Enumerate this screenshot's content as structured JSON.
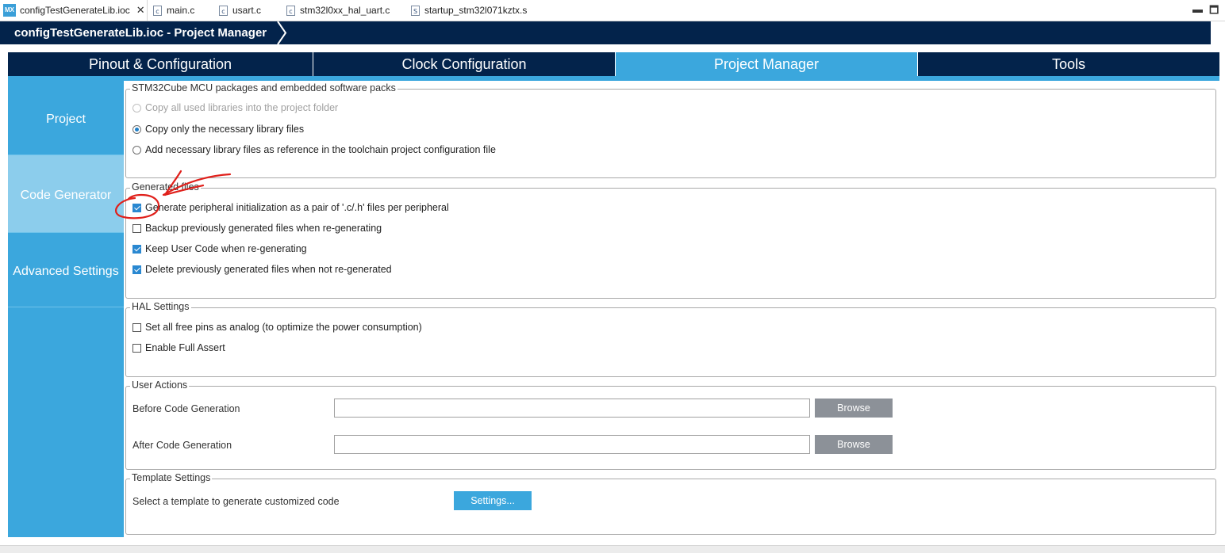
{
  "editor_tabs": [
    {
      "label": "configTestGenerateLib.ioc",
      "icon": "mx-icon"
    },
    {
      "label": "main.c",
      "icon": "c-file-icon"
    },
    {
      "label": "usart.c",
      "icon": "c-file-icon"
    },
    {
      "label": "stm32l0xx_hal_uart.c",
      "icon": "c-file-icon"
    },
    {
      "label": "startup_stm32l071kztx.s",
      "icon": "s-file-icon"
    }
  ],
  "mx_icon_text": "MX",
  "breadcrumb": "configTestGenerateLib.ioc - Project Manager",
  "main_tabs": [
    "Pinout & Configuration",
    "Clock Configuration",
    "Project Manager",
    "Tools"
  ],
  "active_main_tab": "Project Manager",
  "side_nav": [
    "Project",
    "Code Generator",
    "Advanced Settings"
  ],
  "active_side_nav": "Code Generator",
  "packages": {
    "legend": "STM32Cube MCU packages and embedded software packs",
    "options": [
      {
        "label": "Copy all used libraries into the project folder",
        "selected": false,
        "disabled": true
      },
      {
        "label": "Copy only the necessary library files",
        "selected": true,
        "disabled": false
      },
      {
        "label": "Add necessary library files as reference in the toolchain project configuration file",
        "selected": false,
        "disabled": false
      }
    ]
  },
  "generated_files": {
    "legend": "Generated files",
    "options": [
      {
        "label": "Generate peripheral initialization as a pair of '.c/.h' files per peripheral",
        "checked": true
      },
      {
        "label": "Backup previously generated files when re-generating",
        "checked": false
      },
      {
        "label": "Keep User Code when re-generating",
        "checked": true
      },
      {
        "label": "Delete previously generated files when not re-generated",
        "checked": true
      }
    ]
  },
  "hal_settings": {
    "legend": "HAL Settings",
    "options": [
      {
        "label": "Set all free pins as analog (to optimize the power consumption)",
        "checked": false
      },
      {
        "label": "Enable Full Assert",
        "checked": false
      }
    ]
  },
  "user_actions": {
    "legend": "User Actions",
    "before_label": "Before Code Generation",
    "before_value": "",
    "after_label": "After Code Generation",
    "after_value": "",
    "browse_label": "Browse"
  },
  "template_settings": {
    "legend": "Template Settings",
    "label": "Select a template to generate customized code",
    "button": "Settings..."
  },
  "colors": {
    "navy": "#03234b",
    "accent_blue": "#3ba7dd",
    "annotation_red": "#e0201b"
  }
}
